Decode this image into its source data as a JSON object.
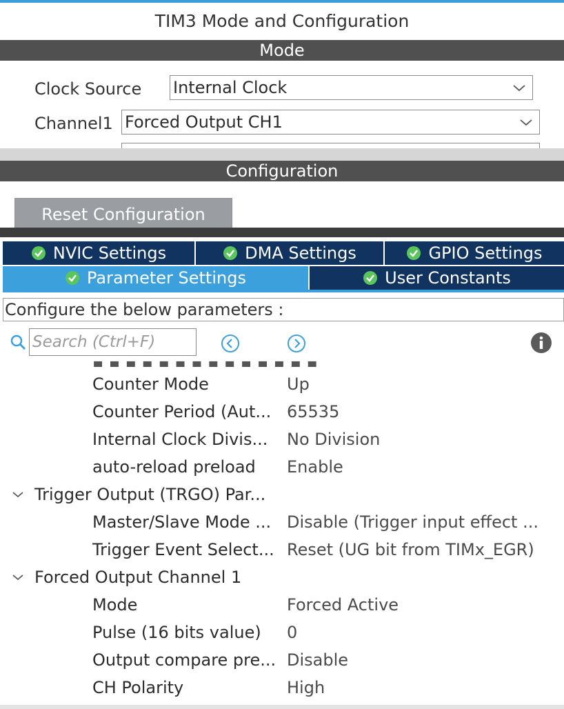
{
  "window": {
    "title": "TIM3 Mode and Configuration"
  },
  "sections": {
    "mode": "Mode",
    "configuration": "Configuration"
  },
  "mode": {
    "clock_source_label": "Clock Source",
    "clock_source_value": "Internal Clock",
    "channel1_label": "Channel1",
    "channel1_value": "Forced Output CH1"
  },
  "reset_button": "Reset Configuration",
  "tabs": {
    "nvic": "NVIC Settings",
    "dma": "DMA Settings",
    "gpio": "GPIO Settings",
    "parameter": "Parameter Settings",
    "user_constants": "User Constants"
  },
  "info_text": "Configure the below parameters :",
  "search": {
    "placeholder": "Search (Ctrl+F)"
  },
  "icons": {
    "check": "check-circle-icon",
    "search": "search-icon",
    "prev": "circle-left-arrow-icon",
    "next": "circle-right-arrow-icon",
    "info": "info-icon",
    "dropdown": "chevron-down-icon",
    "collapse": "caret-down-icon"
  },
  "colors": {
    "accent": "#3ba0dc",
    "tab_dark": "#10335f",
    "section_bar": "#505050",
    "button_gray": "#9a9ea2"
  },
  "tree": {
    "params": [
      {
        "name": "Counter Mode",
        "value": "Up"
      },
      {
        "name": "Counter Period (Aut...",
        "value": "65535"
      },
      {
        "name": "Internal Clock Divis...",
        "value": "No Division"
      },
      {
        "name": "auto-reload preload",
        "value": "Enable"
      }
    ],
    "trgo_group": "Trigger Output (TRGO) Par...",
    "trgo_params": [
      {
        "name": "Master/Slave Mode ...",
        "value": "Disable (Trigger input effect ..."
      },
      {
        "name": "Trigger Event Select...",
        "value": "Reset (UG bit from TIMx_EGR)"
      }
    ],
    "forced_group": "Forced Output Channel 1",
    "forced_params": [
      {
        "name": "Mode",
        "value": "Forced Active"
      },
      {
        "name": "Pulse (16 bits value)",
        "value": "0"
      },
      {
        "name": "Output compare pre...",
        "value": "Disable"
      },
      {
        "name": "CH Polarity",
        "value": "High"
      }
    ]
  }
}
